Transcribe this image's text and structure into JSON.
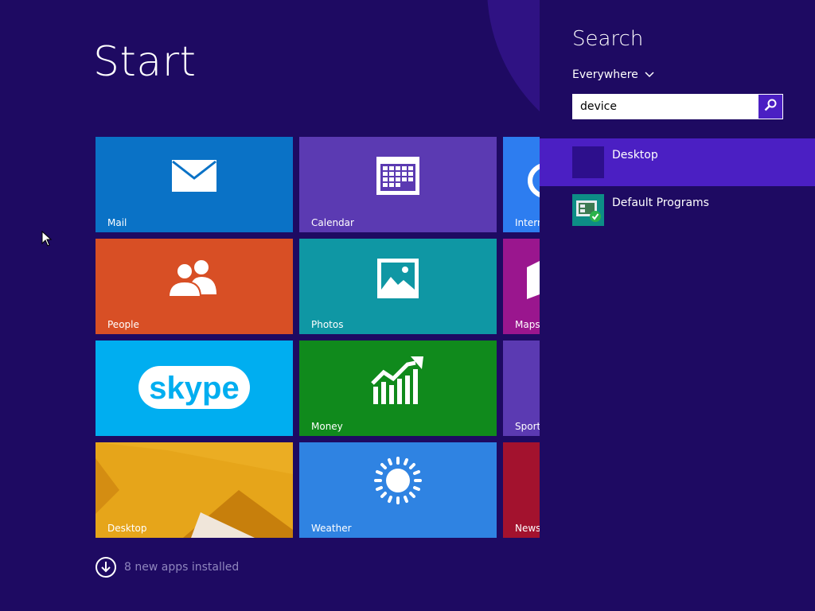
{
  "start": {
    "title": "Start",
    "apps_installed": "8 new apps installed"
  },
  "tiles": [
    {
      "name": "Mail",
      "color": "#0a72c6",
      "icon": "mail-icon"
    },
    {
      "name": "Calendar",
      "color": "#5b3ab2",
      "icon": "calendar-icon"
    },
    {
      "name": "Internet Explorer",
      "label_visible": "Intern",
      "color": "#2d7df0",
      "icon": "ie-icon"
    },
    {
      "name": "People",
      "color": "#d84f25",
      "icon": "people-icon"
    },
    {
      "name": "Photos",
      "color": "#0f97a4",
      "icon": "photos-icon"
    },
    {
      "name": "Maps",
      "color": "#9a168e",
      "icon": "maps-icon"
    },
    {
      "name": "skype",
      "color": "#00aef0",
      "icon": "skype-logo"
    },
    {
      "name": "Money",
      "color": "#108a1c",
      "icon": "chart-up-icon"
    },
    {
      "name": "Sports",
      "color": "#5b3ab2",
      "icon": "sports-icon"
    },
    {
      "name": "Desktop",
      "color": "#e6a51a",
      "icon": "desktop-wallpaper"
    },
    {
      "name": "Weather",
      "color": "#2f83e2",
      "icon": "sun-icon"
    },
    {
      "name": "News",
      "color": "#a3122e",
      "icon": "news-icon"
    }
  ],
  "search": {
    "title": "Search",
    "scope": "Everywhere",
    "query": "device",
    "results": [
      {
        "name": "Desktop",
        "selected": true,
        "icon": "desktop-app-icon"
      },
      {
        "name": "Default Programs",
        "selected": false,
        "icon": "default-programs-icon"
      }
    ]
  },
  "colors": {
    "background": "#1e0a62",
    "accent": "#4b1fc3"
  }
}
